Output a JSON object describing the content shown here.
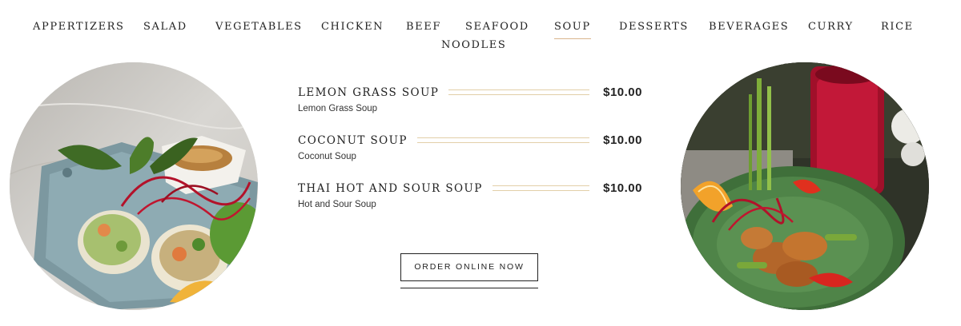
{
  "nav": {
    "items": [
      {
        "label": "APPERTIZERS"
      },
      {
        "label": "SALAD"
      },
      {
        "label": "VEGETABLES"
      },
      {
        "label": "CHICKEN"
      },
      {
        "label": "BEEF"
      },
      {
        "label": "SEAFOOD"
      },
      {
        "label": "SOUP",
        "active": true
      },
      {
        "label": "DESSERTS"
      },
      {
        "label": "BEVERAGES"
      },
      {
        "label": "CURRY"
      },
      {
        "label": "RICE"
      },
      {
        "label": "NOODLES"
      }
    ],
    "active_label": "SOUP"
  },
  "menu": {
    "items": [
      {
        "name": "LEMON GRASS SOUP",
        "price": "$10.00",
        "description": "Lemon Grass Soup"
      },
      {
        "name": "COCONUT SOUP",
        "price": "$10.00",
        "description": "Coconut Soup"
      },
      {
        "name": "THAI HOT AND SOUR SOUP",
        "price": "$10.00",
        "description": "Hot and Sour Soup"
      }
    ]
  },
  "cta": {
    "label": "ORDER ONLINE NOW"
  },
  "colors": {
    "accent": "#d9b58c",
    "leader_line": "#e2cfa8",
    "text": "#222222"
  }
}
